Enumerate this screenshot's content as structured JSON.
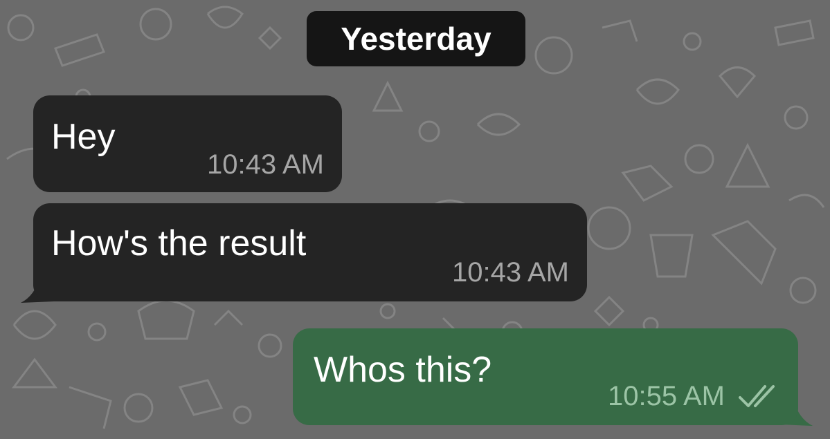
{
  "chat": {
    "date_separator": "Yesterday",
    "messages": [
      {
        "direction": "incoming",
        "text": "Hey",
        "time": "10:43 AM"
      },
      {
        "direction": "incoming",
        "text": "How's the result",
        "time": "10:43 AM"
      },
      {
        "direction": "outgoing",
        "text": "Whos this?",
        "time": "10:55 AM",
        "status_icon": "double-check-icon"
      }
    ]
  },
  "colors": {
    "background": "#6b6b6b",
    "incoming_bubble": "#242424",
    "outgoing_bubble": "#376b46",
    "date_chip": "#151515"
  }
}
